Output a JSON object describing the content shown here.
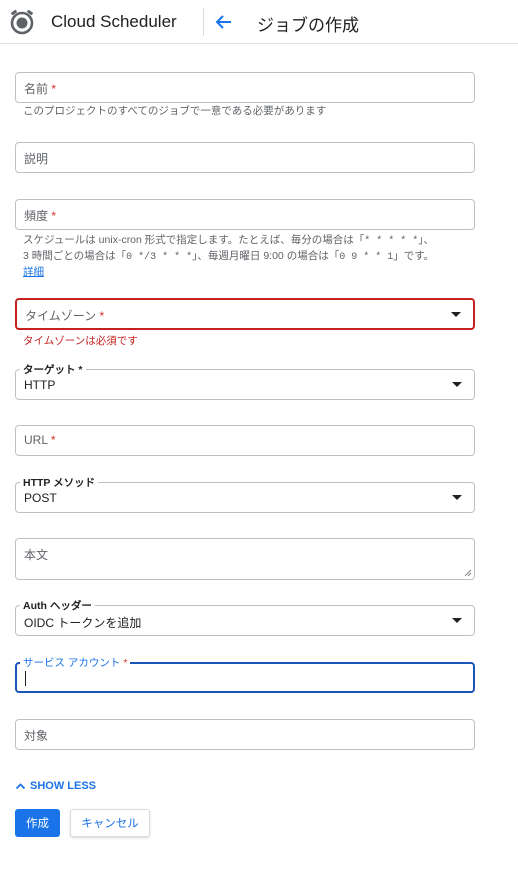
{
  "header": {
    "app_title": "Cloud Scheduler",
    "page_title": "ジョブの作成",
    "logo_icon": "cloud-scheduler-logo-icon",
    "back_icon": "arrow-back-icon"
  },
  "form": {
    "name": {
      "label": "名前",
      "required_mark": "*",
      "helper": "このプロジェクトのすべてのジョブで一意である必要があります"
    },
    "description": {
      "label": "説明"
    },
    "frequency": {
      "label": "頻度",
      "required_mark": "*",
      "helper_line1_a": "スケジュールは unix-cron 形式で指定します。たとえば、毎分の場合は「",
      "helper_line1_code": "* * * * *",
      "helper_line1_b": "」、",
      "helper_line2_a": "3 時間ごとの場合は「",
      "helper_line2_code1": "0 */3 * * *",
      "helper_line2_b": "」、毎週月曜日 9:00 の場合は「",
      "helper_line2_code2": "0 9 * * 1",
      "helper_line2_c": "」です。",
      "details_link": "詳細"
    },
    "timezone": {
      "label": "タイムゾーン",
      "required_mark": "*",
      "error": "タイムゾーンは必須です"
    },
    "target": {
      "label": "ターゲット",
      "required_mark": "*",
      "value": "HTTP"
    },
    "url": {
      "label": "URL",
      "required_mark": "*"
    },
    "http_method": {
      "label": "HTTP メソッド",
      "value": "POST"
    },
    "body": {
      "label": "本文"
    },
    "auth_header": {
      "label": "Auth ヘッダー",
      "value": "OIDC トークンを追加"
    },
    "service_account": {
      "label": "サービス アカウント",
      "required_mark": "*",
      "value": ""
    },
    "audience": {
      "label": "対象"
    }
  },
  "actions": {
    "show_less": "SHOW LESS",
    "create": "作成",
    "cancel": "キャンセル"
  },
  "colors": {
    "accent": "#1a73e8",
    "error": "#c5221f",
    "focus": "#1a56b8"
  }
}
